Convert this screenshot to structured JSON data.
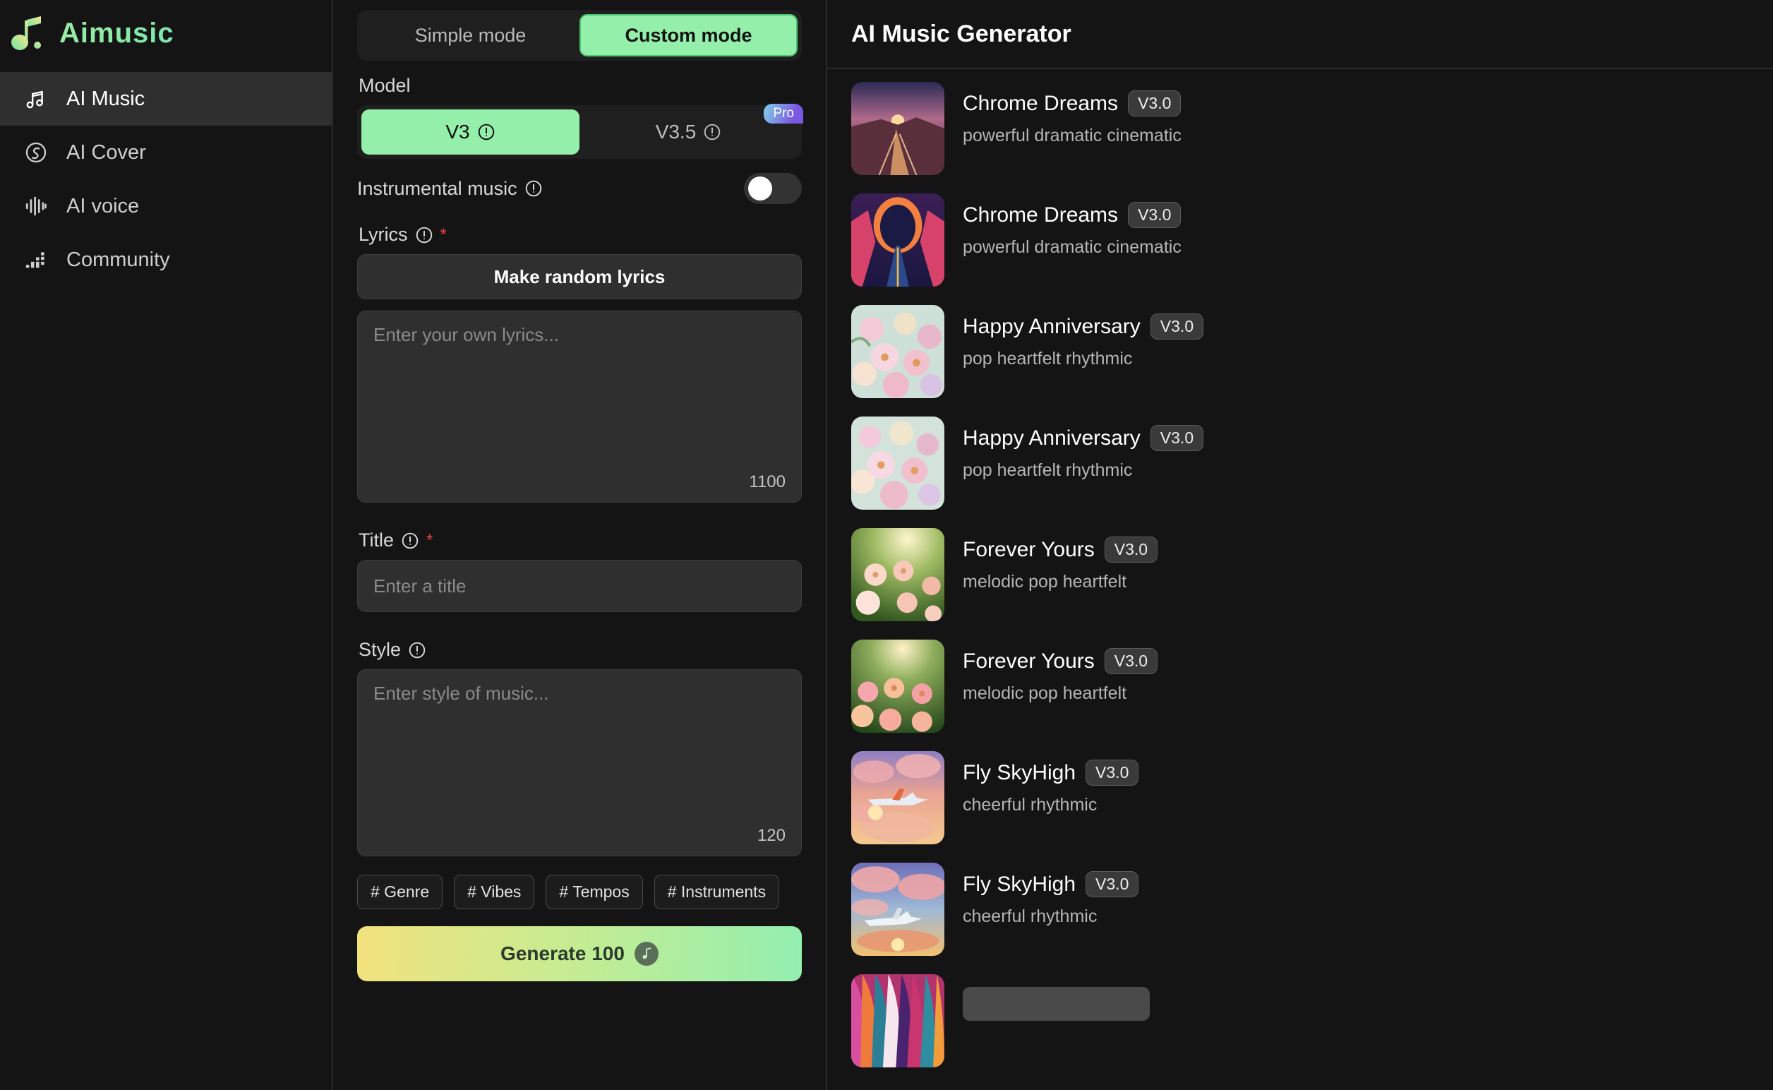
{
  "brand": {
    "name": "Aimusic",
    "logo_icon": "music-note-icon"
  },
  "sidebar": {
    "items": [
      {
        "label": "AI Music",
        "icon": "music-notes-icon",
        "active": true
      },
      {
        "label": "AI Cover",
        "icon": "shazam-swirl-icon",
        "active": false
      },
      {
        "label": "AI voice",
        "icon": "waveform-icon",
        "active": false
      },
      {
        "label": "Community",
        "icon": "equalizer-bars-icon",
        "active": false
      }
    ]
  },
  "form": {
    "modes": [
      {
        "label": "Simple mode",
        "active": false
      },
      {
        "label": "Custom mode",
        "active": true
      }
    ],
    "model": {
      "label": "Model",
      "options": [
        {
          "label": "V3",
          "active": true,
          "info_icon": "info-circle-icon"
        },
        {
          "label": "V3.5",
          "active": false,
          "info_icon": "info-circle-icon",
          "badge": "Pro"
        }
      ]
    },
    "instrumental": {
      "label": "Instrumental music",
      "info_icon": "info-circle-icon",
      "toggle_state": "off"
    },
    "lyrics": {
      "label": "Lyrics",
      "info_icon": "info-circle-icon",
      "required_marker": "*",
      "random_button": "Make random lyrics",
      "placeholder": "Enter your own lyrics...",
      "value": "",
      "counter": "1100"
    },
    "title": {
      "label": "Title",
      "info_icon": "info-circle-icon",
      "required_marker": "*",
      "placeholder": "Enter a title",
      "value": ""
    },
    "style": {
      "label": "Style",
      "info_icon": "info-circle-icon",
      "placeholder": "Enter style of music...",
      "value": "",
      "counter": "120"
    },
    "tags": [
      "# Genre",
      "# Vibes",
      "# Tempos",
      "# Instruments"
    ],
    "generate": {
      "label": "Generate 100",
      "icon": "music-note-icon"
    }
  },
  "results": {
    "title": "AI Music Generator",
    "tracks": [
      {
        "title": "Chrome Dreams",
        "version": "V3.0",
        "desc": "powerful dramatic cinematic",
        "art": "sunset-canyon-road",
        "loading": false
      },
      {
        "title": "Chrome Dreams",
        "version": "V3.0",
        "desc": "powerful dramatic cinematic",
        "art": "neon-portal-road",
        "loading": false
      },
      {
        "title": "Happy Anniversary",
        "version": "V3.0",
        "desc": "pop heartfelt rhythmic",
        "art": "pastel-roses",
        "loading": false
      },
      {
        "title": "Happy Anniversary",
        "version": "V3.0",
        "desc": "pop heartfelt rhythmic",
        "art": "pastel-roses",
        "loading": false
      },
      {
        "title": "Forever Yours",
        "version": "V3.0",
        "desc": "melodic pop heartfelt",
        "art": "sunlit-rose-garden",
        "loading": false
      },
      {
        "title": "Forever Yours",
        "version": "V3.0",
        "desc": "melodic pop heartfelt",
        "art": "sunlit-rose-garden",
        "loading": false
      },
      {
        "title": "Fly SkyHigh",
        "version": "V3.0",
        "desc": "cheerful rhythmic",
        "art": "plane-sunset-clouds",
        "loading": false
      },
      {
        "title": "Fly SkyHigh",
        "version": "V3.0",
        "desc": "cheerful rhythmic",
        "art": "plane-sunset-clouds",
        "loading": false
      },
      {
        "title": "",
        "version": "",
        "desc": "",
        "art": "colorful-swirl",
        "loading": true
      }
    ]
  },
  "colors": {
    "accent_green": "#93efaa",
    "accent_yellow": "#f2e27e",
    "required_red": "#ef4444",
    "pro_badge_from": "#7fd2e9",
    "pro_badge_to": "#7b58e3",
    "bg": "#141414",
    "panel_input": "#2f2f2f"
  }
}
